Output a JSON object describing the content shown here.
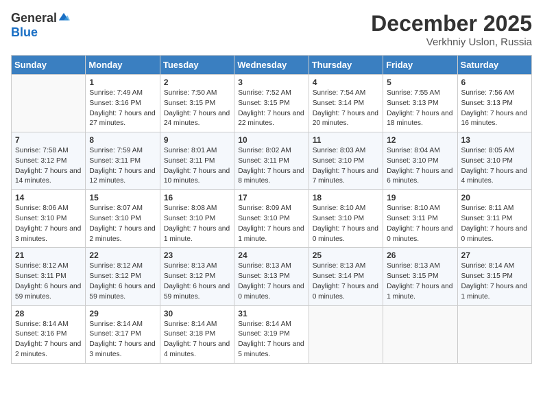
{
  "logo": {
    "general": "General",
    "blue": "Blue"
  },
  "header": {
    "month": "December 2025",
    "location": "Verkhniy Uslon, Russia"
  },
  "days_of_week": [
    "Sunday",
    "Monday",
    "Tuesday",
    "Wednesday",
    "Thursday",
    "Friday",
    "Saturday"
  ],
  "weeks": [
    [
      {
        "day": null
      },
      {
        "day": "1",
        "sunrise": "Sunrise: 7:49 AM",
        "sunset": "Sunset: 3:16 PM",
        "daylight": "Daylight: 7 hours and 27 minutes."
      },
      {
        "day": "2",
        "sunrise": "Sunrise: 7:50 AM",
        "sunset": "Sunset: 3:15 PM",
        "daylight": "Daylight: 7 hours and 24 minutes."
      },
      {
        "day": "3",
        "sunrise": "Sunrise: 7:52 AM",
        "sunset": "Sunset: 3:15 PM",
        "daylight": "Daylight: 7 hours and 22 minutes."
      },
      {
        "day": "4",
        "sunrise": "Sunrise: 7:54 AM",
        "sunset": "Sunset: 3:14 PM",
        "daylight": "Daylight: 7 hours and 20 minutes."
      },
      {
        "day": "5",
        "sunrise": "Sunrise: 7:55 AM",
        "sunset": "Sunset: 3:13 PM",
        "daylight": "Daylight: 7 hours and 18 minutes."
      },
      {
        "day": "6",
        "sunrise": "Sunrise: 7:56 AM",
        "sunset": "Sunset: 3:13 PM",
        "daylight": "Daylight: 7 hours and 16 minutes."
      }
    ],
    [
      {
        "day": "7",
        "sunrise": "Sunrise: 7:58 AM",
        "sunset": "Sunset: 3:12 PM",
        "daylight": "Daylight: 7 hours and 14 minutes."
      },
      {
        "day": "8",
        "sunrise": "Sunrise: 7:59 AM",
        "sunset": "Sunset: 3:11 PM",
        "daylight": "Daylight: 7 hours and 12 minutes."
      },
      {
        "day": "9",
        "sunrise": "Sunrise: 8:01 AM",
        "sunset": "Sunset: 3:11 PM",
        "daylight": "Daylight: 7 hours and 10 minutes."
      },
      {
        "day": "10",
        "sunrise": "Sunrise: 8:02 AM",
        "sunset": "Sunset: 3:11 PM",
        "daylight": "Daylight: 7 hours and 8 minutes."
      },
      {
        "day": "11",
        "sunrise": "Sunrise: 8:03 AM",
        "sunset": "Sunset: 3:10 PM",
        "daylight": "Daylight: 7 hours and 7 minutes."
      },
      {
        "day": "12",
        "sunrise": "Sunrise: 8:04 AM",
        "sunset": "Sunset: 3:10 PM",
        "daylight": "Daylight: 7 hours and 6 minutes."
      },
      {
        "day": "13",
        "sunrise": "Sunrise: 8:05 AM",
        "sunset": "Sunset: 3:10 PM",
        "daylight": "Daylight: 7 hours and 4 minutes."
      }
    ],
    [
      {
        "day": "14",
        "sunrise": "Sunrise: 8:06 AM",
        "sunset": "Sunset: 3:10 PM",
        "daylight": "Daylight: 7 hours and 3 minutes."
      },
      {
        "day": "15",
        "sunrise": "Sunrise: 8:07 AM",
        "sunset": "Sunset: 3:10 PM",
        "daylight": "Daylight: 7 hours and 2 minutes."
      },
      {
        "day": "16",
        "sunrise": "Sunrise: 8:08 AM",
        "sunset": "Sunset: 3:10 PM",
        "daylight": "Daylight: 7 hours and 1 minute."
      },
      {
        "day": "17",
        "sunrise": "Sunrise: 8:09 AM",
        "sunset": "Sunset: 3:10 PM",
        "daylight": "Daylight: 7 hours and 1 minute."
      },
      {
        "day": "18",
        "sunrise": "Sunrise: 8:10 AM",
        "sunset": "Sunset: 3:10 PM",
        "daylight": "Daylight: 7 hours and 0 minutes."
      },
      {
        "day": "19",
        "sunrise": "Sunrise: 8:10 AM",
        "sunset": "Sunset: 3:11 PM",
        "daylight": "Daylight: 7 hours and 0 minutes."
      },
      {
        "day": "20",
        "sunrise": "Sunrise: 8:11 AM",
        "sunset": "Sunset: 3:11 PM",
        "daylight": "Daylight: 7 hours and 0 minutes."
      }
    ],
    [
      {
        "day": "21",
        "sunrise": "Sunrise: 8:12 AM",
        "sunset": "Sunset: 3:11 PM",
        "daylight": "Daylight: 6 hours and 59 minutes."
      },
      {
        "day": "22",
        "sunrise": "Sunrise: 8:12 AM",
        "sunset": "Sunset: 3:12 PM",
        "daylight": "Daylight: 6 hours and 59 minutes."
      },
      {
        "day": "23",
        "sunrise": "Sunrise: 8:13 AM",
        "sunset": "Sunset: 3:12 PM",
        "daylight": "Daylight: 6 hours and 59 minutes."
      },
      {
        "day": "24",
        "sunrise": "Sunrise: 8:13 AM",
        "sunset": "Sunset: 3:13 PM",
        "daylight": "Daylight: 7 hours and 0 minutes."
      },
      {
        "day": "25",
        "sunrise": "Sunrise: 8:13 AM",
        "sunset": "Sunset: 3:14 PM",
        "daylight": "Daylight: 7 hours and 0 minutes."
      },
      {
        "day": "26",
        "sunrise": "Sunrise: 8:13 AM",
        "sunset": "Sunset: 3:15 PM",
        "daylight": "Daylight: 7 hours and 1 minute."
      },
      {
        "day": "27",
        "sunrise": "Sunrise: 8:14 AM",
        "sunset": "Sunset: 3:15 PM",
        "daylight": "Daylight: 7 hours and 1 minute."
      }
    ],
    [
      {
        "day": "28",
        "sunrise": "Sunrise: 8:14 AM",
        "sunset": "Sunset: 3:16 PM",
        "daylight": "Daylight: 7 hours and 2 minutes."
      },
      {
        "day": "29",
        "sunrise": "Sunrise: 8:14 AM",
        "sunset": "Sunset: 3:17 PM",
        "daylight": "Daylight: 7 hours and 3 minutes."
      },
      {
        "day": "30",
        "sunrise": "Sunrise: 8:14 AM",
        "sunset": "Sunset: 3:18 PM",
        "daylight": "Daylight: 7 hours and 4 minutes."
      },
      {
        "day": "31",
        "sunrise": "Sunrise: 8:14 AM",
        "sunset": "Sunset: 3:19 PM",
        "daylight": "Daylight: 7 hours and 5 minutes."
      },
      {
        "day": null
      },
      {
        "day": null
      },
      {
        "day": null
      }
    ]
  ]
}
